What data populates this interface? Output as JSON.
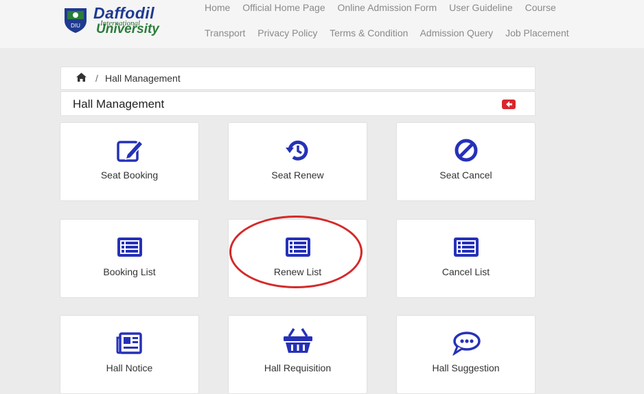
{
  "header": {
    "logo": {
      "line1": "Daffodil",
      "line2": "International",
      "line3": "University"
    },
    "nav_row1": [
      "Home",
      "Official Home Page",
      "Online Admission Form",
      "User Guideline",
      "Course"
    ],
    "nav_row2": [
      "Transport",
      "Privacy Policy",
      "Terms & Condition",
      "Admission Query",
      "Job Placement"
    ]
  },
  "breadcrumb": {
    "home_icon": "home-icon",
    "separator": "/",
    "current": "Hall Management"
  },
  "panel": {
    "title": "Hall Management",
    "back_icon": "arrow-left-icon"
  },
  "cards": [
    {
      "label": "Seat Booking",
      "icon": "edit-icon"
    },
    {
      "label": "Seat Renew",
      "icon": "history-icon"
    },
    {
      "label": "Seat Cancel",
      "icon": "ban-icon"
    },
    {
      "label": "Booking List",
      "icon": "list-icon"
    },
    {
      "label": "Renew List",
      "icon": "list-icon"
    },
    {
      "label": "Cancel List",
      "icon": "list-icon"
    },
    {
      "label": "Hall Notice",
      "icon": "newspaper-icon"
    },
    {
      "label": "Hall Requisition",
      "icon": "basket-icon"
    },
    {
      "label": "Hall Suggestion",
      "icon": "comment-dots-icon"
    }
  ],
  "colors": {
    "icon_blue": "#2631b8",
    "accent_red": "#d9262d",
    "highlight_red": "#d42a2a"
  }
}
